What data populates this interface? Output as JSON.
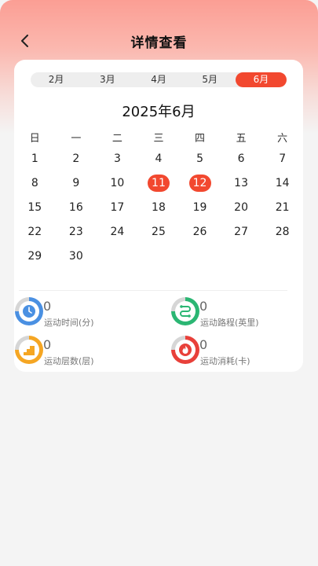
{
  "header": {
    "title": "详情查看"
  },
  "month_tabs": [
    "2月",
    "3月",
    "4月",
    "5月",
    "6月"
  ],
  "active_month_index": 4,
  "calendar": {
    "title": "2025年6月",
    "weekdays": [
      "日",
      "一",
      "二",
      "三",
      "四",
      "五",
      "六"
    ],
    "weeks": [
      [
        "1",
        "2",
        "3",
        "4",
        "5",
        "6",
        "7"
      ],
      [
        "8",
        "9",
        "10",
        "11",
        "12",
        "13",
        "14"
      ],
      [
        "15",
        "16",
        "17",
        "18",
        "19",
        "20",
        "21"
      ],
      [
        "22",
        "23",
        "24",
        "25",
        "26",
        "27",
        "28"
      ],
      [
        "29",
        "30",
        "",
        "",
        "",
        "",
        ""
      ]
    ],
    "selected_days": [
      "11",
      "12"
    ]
  },
  "stats": {
    "time": {
      "value": "0",
      "label": "运动时间(分)",
      "icon": "clock-icon",
      "color": "#4a90e2"
    },
    "distance": {
      "value": "0",
      "label": "运动路程(英里)",
      "icon": "route-icon",
      "color": "#2bb673"
    },
    "floors": {
      "value": "0",
      "label": "运动层数(层)",
      "icon": "stairs-icon",
      "color": "#f5a623"
    },
    "calories": {
      "value": "0",
      "label": "运动消耗(卡)",
      "icon": "flame-icon",
      "color": "#e8403a"
    }
  },
  "colors": {
    "accent": "#f2482f"
  }
}
